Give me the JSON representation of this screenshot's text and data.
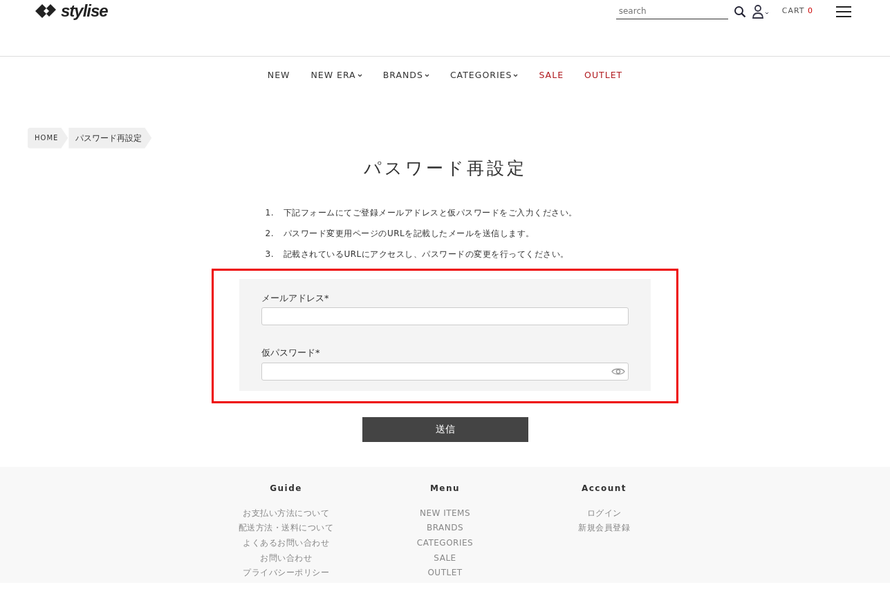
{
  "header": {
    "logo": "stylise",
    "search": {
      "placeholder": "search"
    },
    "cart": {
      "label": "CART",
      "count": "0"
    }
  },
  "nav": [
    {
      "label": "NEW",
      "dropdown": false,
      "color": "#333333"
    },
    {
      "label": "NEW ERA",
      "dropdown": true,
      "color": "#333333"
    },
    {
      "label": "BRANDS",
      "dropdown": true,
      "color": "#333333"
    },
    {
      "label": "CATEGORIES",
      "dropdown": true,
      "color": "#333333"
    },
    {
      "label": "SALE",
      "dropdown": false,
      "color": "#b0191e"
    },
    {
      "label": "OUTLET",
      "dropdown": false,
      "color": "#b0191e"
    }
  ],
  "breadcrumb": [
    "HOME",
    "パスワード再設定"
  ],
  "title": "パスワード再設定",
  "steps": [
    {
      "number": "1.",
      "text": "下記フォームにてご登録メールアドレスと仮パスワードをご入力ください。"
    },
    {
      "number": "2.",
      "text": "パスワード変更用ページのURLを記載したメールを送信します。"
    },
    {
      "number": "3.",
      "text": "記載されているURLにアクセスし、パスワードの変更を行ってください。"
    }
  ],
  "form": {
    "fields": [
      {
        "label": "メールアドレス",
        "required_mark": "*",
        "kind": "email"
      },
      {
        "label": "仮パスワード",
        "required_mark": "*",
        "kind": "password"
      }
    ],
    "highlighted": true
  },
  "submit": "送信",
  "footer": {
    "columns": [
      {
        "title": "Guide",
        "links": [
          "お支払い方法について",
          "配送方法・送料について",
          "よくあるお問い合わせ",
          "お問い合わせ",
          "プライバシーポリシー"
        ]
      },
      {
        "title": "Menu",
        "links": [
          "NEW ITEMS",
          "BRANDS",
          "CATEGORIES",
          "SALE",
          "OUTLET"
        ]
      },
      {
        "title": "Account",
        "links": [
          "ログイン",
          "新規会員登録"
        ]
      }
    ]
  }
}
